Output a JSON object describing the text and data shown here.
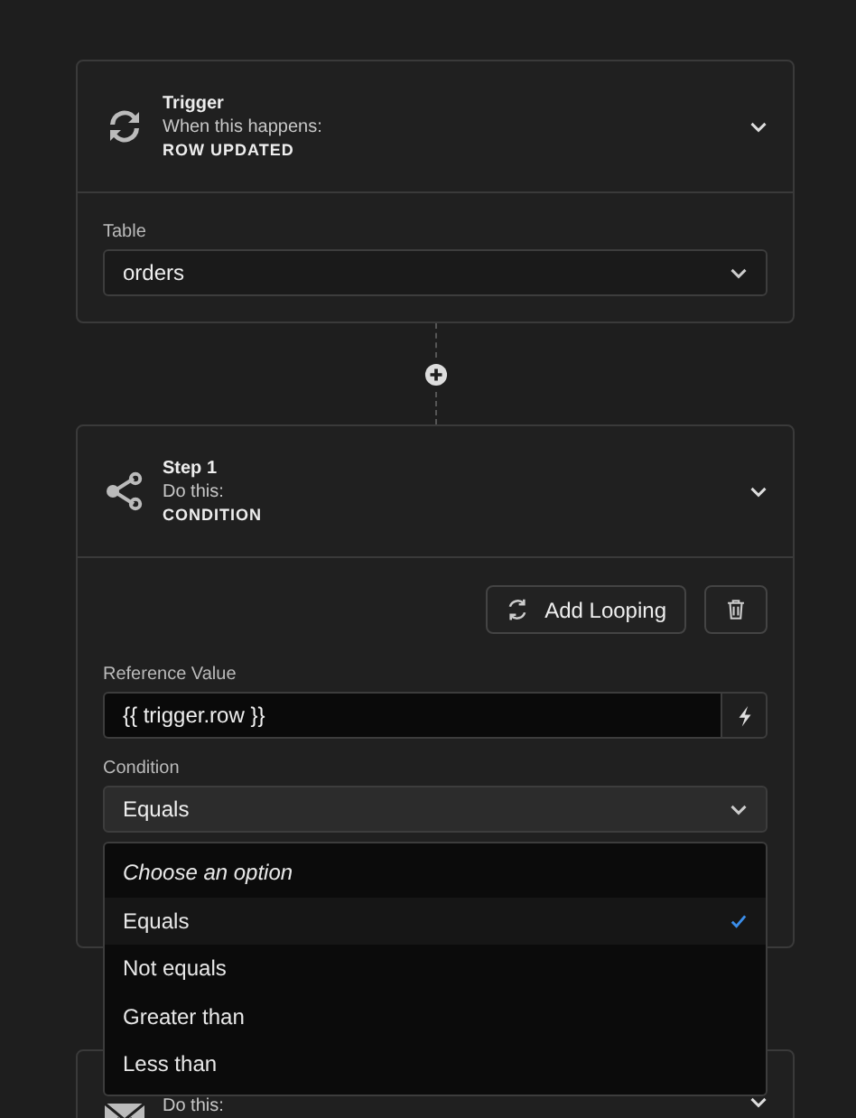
{
  "trigger": {
    "title": "Trigger",
    "subtitle": "When this happens:",
    "action": "ROW UPDATED",
    "fields": [
      {
        "label": "Table",
        "value": "orders"
      }
    ]
  },
  "steps": [
    {
      "title": "Step 1",
      "subtitle": "Do this:",
      "action": "CONDITION",
      "buttons": [
        {
          "kind": "looping",
          "label": "Add Looping"
        },
        {
          "kind": "delete"
        }
      ],
      "reference": {
        "label": "Reference Value",
        "value": "{{ trigger.row }}"
      },
      "condition": {
        "label": "Condition",
        "value": "Equals",
        "options": [
          {
            "label": "Choose an option",
            "kind": "placeholder",
            "selected": false
          },
          {
            "label": "Equals",
            "kind": "option",
            "selected": true
          },
          {
            "label": "Not equals",
            "kind": "option",
            "selected": false
          },
          {
            "label": "Greater than",
            "kind": "option",
            "selected": false
          },
          {
            "label": "Less than",
            "kind": "option",
            "selected": false
          }
        ]
      }
    },
    {
      "subtitle": "Do this:"
    }
  ]
}
